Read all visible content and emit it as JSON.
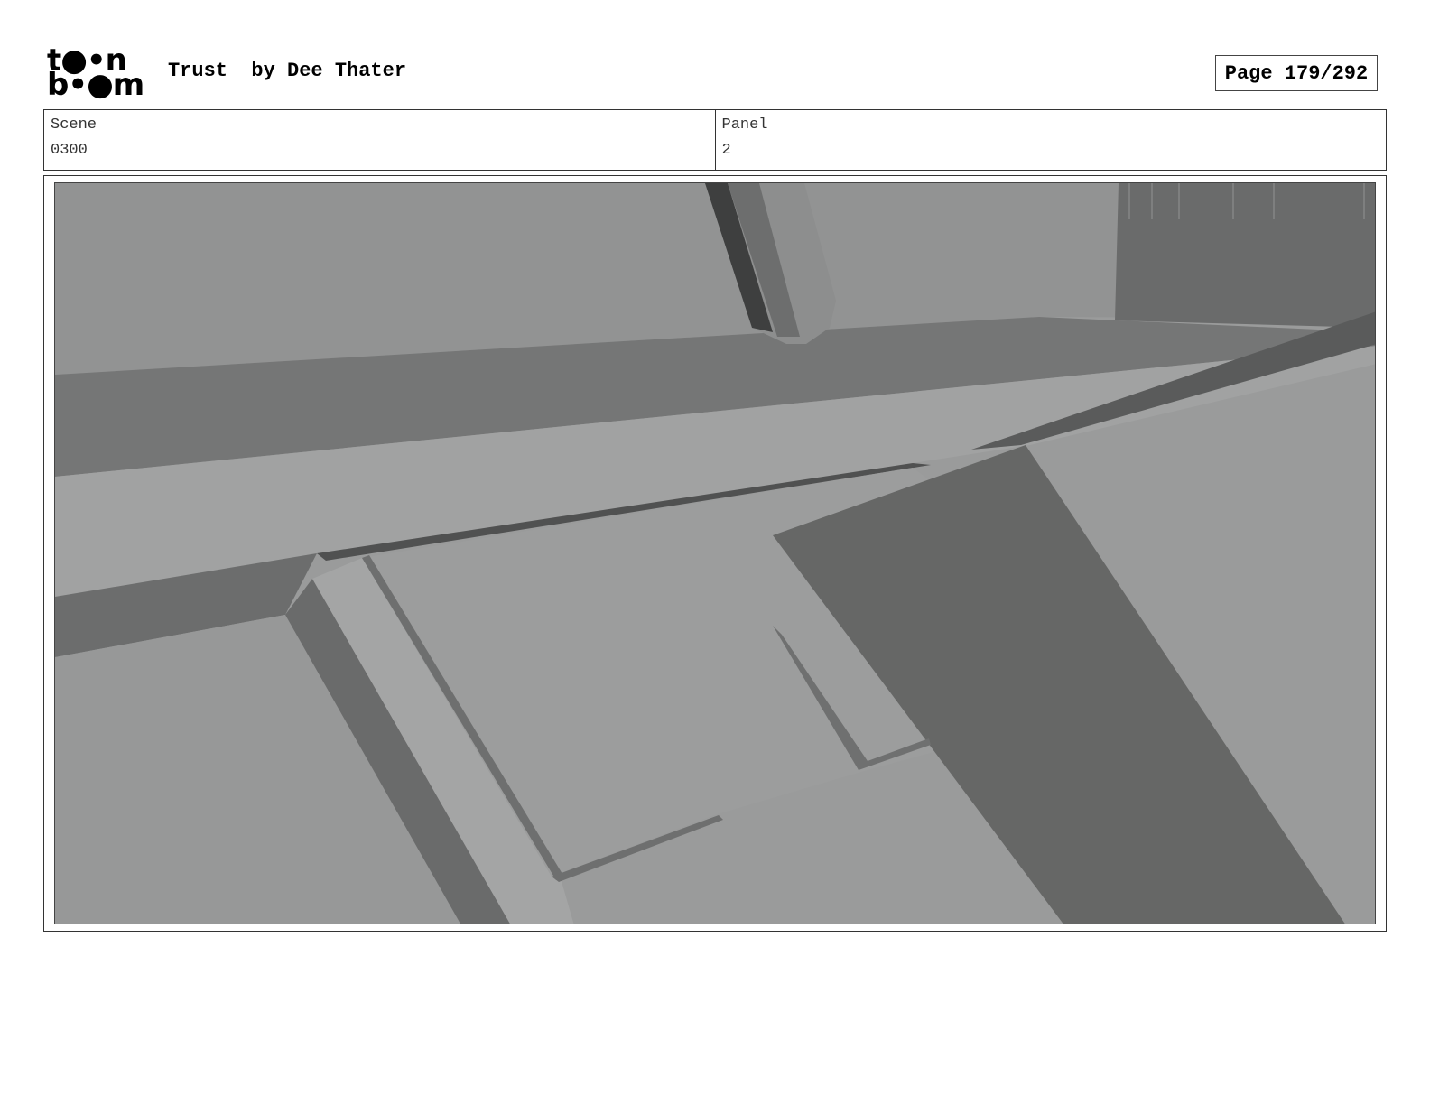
{
  "header": {
    "logo_line1": "t●•n",
    "logo_line2": "b•●m",
    "title": "Trust  by Dee Thater",
    "page_label": "Page 179/292"
  },
  "info": {
    "scene_label": "Scene",
    "scene_value": "0300",
    "panel_label": "Panel",
    "panel_value": "2"
  },
  "panel": {
    "image_description_icon": "3d-render-image",
    "palette": {
      "base": "#9a9b9b",
      "light": "#a3a4a4",
      "mid": "#7b7c7c",
      "dark": "#676867",
      "darker": "#4e4f4f"
    }
  }
}
